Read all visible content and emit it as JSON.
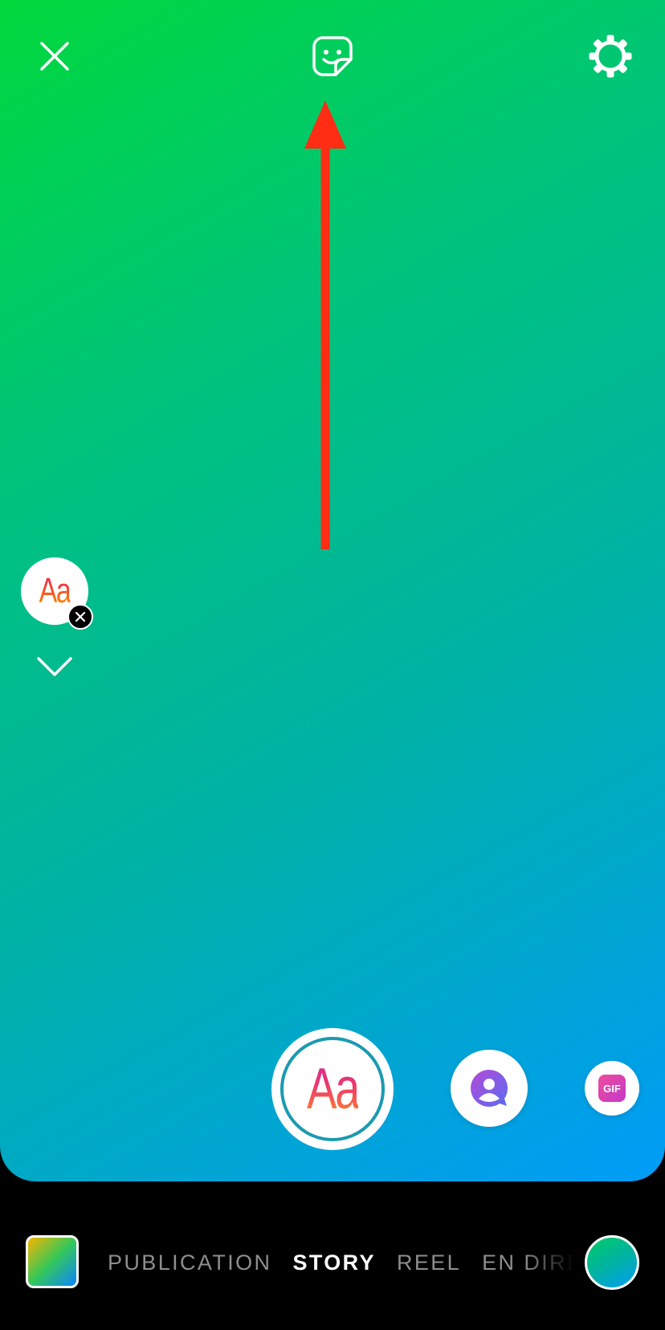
{
  "top_bar": {
    "close_icon": "close-icon",
    "sticker_icon": "sticker-icon",
    "settings_icon": "gear-icon"
  },
  "annotation": {
    "arrow_color": "#ff2d14",
    "arrow_direction": "up"
  },
  "side_tools": {
    "text_style_label": "Aa",
    "remove_icon": "close-icon",
    "collapse_icon": "chevron-down-icon"
  },
  "capture_carousel": {
    "selected_label": "Aa",
    "modes": [
      {
        "name": "mention",
        "icon": "mention-icon"
      },
      {
        "name": "gif",
        "label": "GIF"
      }
    ]
  },
  "bottom_bar": {
    "tabs": [
      {
        "label": "PUBLICATION",
        "active": false
      },
      {
        "label": "STORY",
        "active": true
      },
      {
        "label": "REEL",
        "active": false
      },
      {
        "label": "EN DIRECT",
        "active": false
      }
    ]
  },
  "colors": {
    "background_gradient": [
      "#00d83c",
      "#00b0a8",
      "#009cf8"
    ],
    "accent_ring": "#1a9ab0"
  }
}
